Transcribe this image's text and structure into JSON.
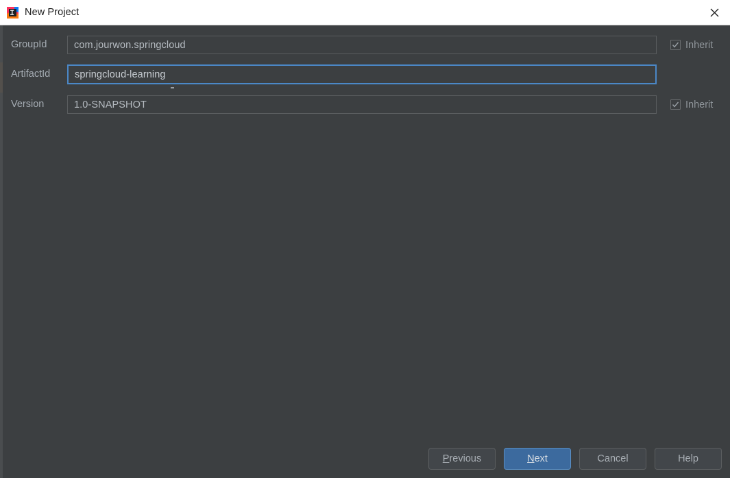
{
  "window": {
    "title": "New Project",
    "app_icon": "intellij-idea-logo-icon",
    "close_icon": "close-icon"
  },
  "form": {
    "rows": [
      {
        "label": "GroupId",
        "value": "com.jourwon.springcloud",
        "focused": false,
        "inherit": {
          "label": "Inherit",
          "checked": true,
          "enabled": false
        }
      },
      {
        "label": "ArtifactId",
        "value": "springcloud-learning",
        "focused": true,
        "inherit": null
      },
      {
        "label": "Version",
        "value": "1.0-SNAPSHOT",
        "focused": false,
        "inherit": {
          "label": "Inherit",
          "checked": true,
          "enabled": false
        }
      }
    ]
  },
  "buttons": {
    "previous": {
      "label": "Previous",
      "mnemonic": "P",
      "primary": false
    },
    "next": {
      "label": "Next",
      "mnemonic": "N",
      "primary": true
    },
    "cancel": {
      "label": "Cancel",
      "mnemonic": "",
      "primary": false
    },
    "help": {
      "label": "Help",
      "mnemonic": "",
      "primary": false
    }
  },
  "colors": {
    "dialog_background": "#3c3f41",
    "titlebar_background": "#ffffff",
    "titlebar_text": "#1a1a1a",
    "label_text": "#a5acb3",
    "field_text": "#b6bcc2",
    "field_border": "#5a5d5f",
    "focus_border": "#4b88c7",
    "primary_button_background": "#3c6a9e",
    "button_background": "#42464a"
  }
}
